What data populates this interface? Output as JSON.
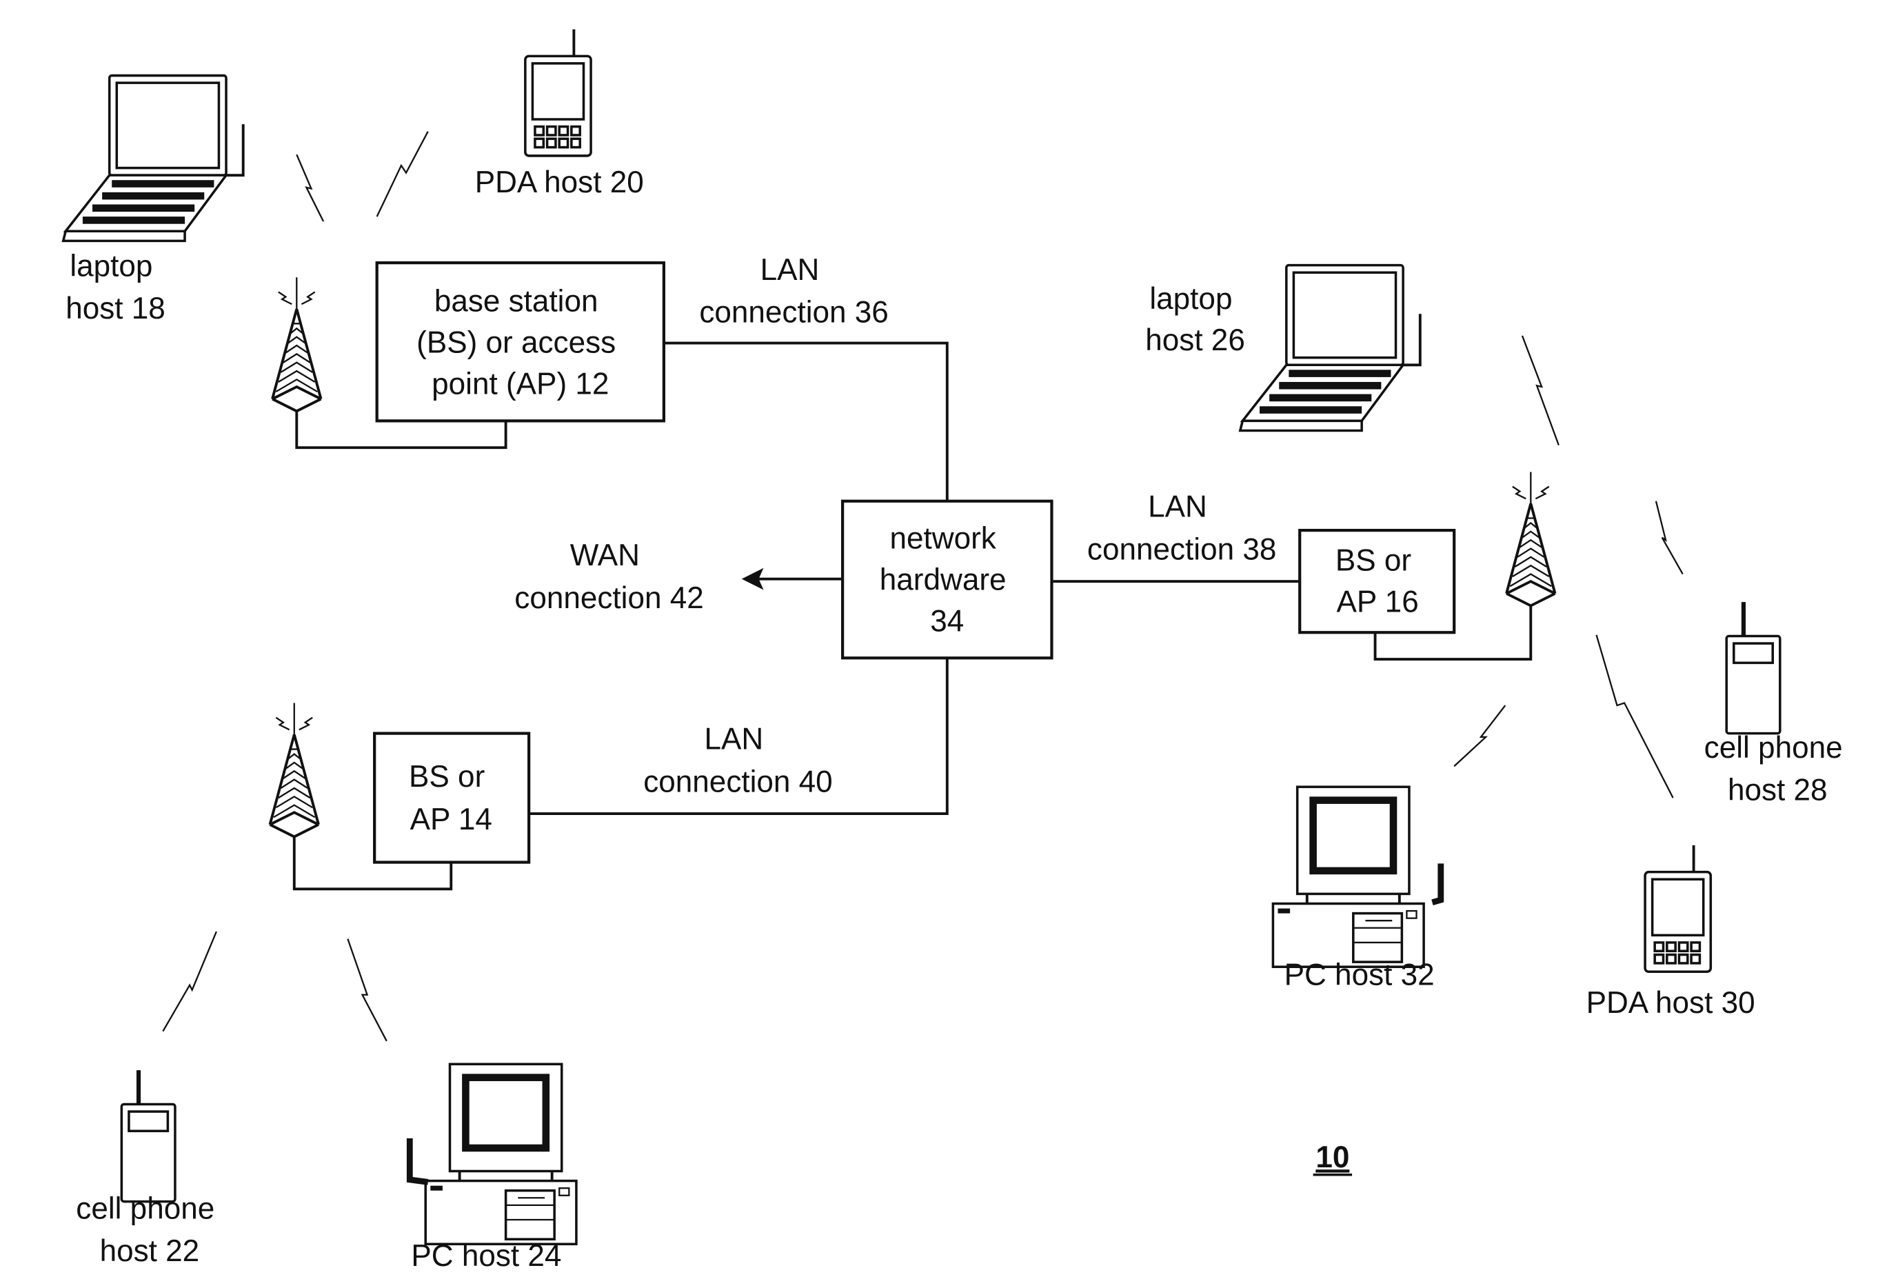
{
  "figure": {
    "number": "10",
    "nodes": {
      "bs12": [
        "base station",
        "(BS) or access",
        "point (AP) 12"
      ],
      "bs14": [
        "BS or",
        "AP 14"
      ],
      "bs16": [
        "BS or",
        "AP 16"
      ],
      "network_hardware": [
        "network",
        "hardware",
        "34"
      ]
    },
    "connections": {
      "lan36": [
        "LAN",
        "connection 36"
      ],
      "lan38": [
        "LAN",
        "connection 38"
      ],
      "lan40": [
        "LAN",
        "connection 40"
      ],
      "wan42": [
        "WAN",
        "connection 42"
      ]
    },
    "hosts": {
      "laptop18": [
        "laptop",
        "host 18"
      ],
      "pda20": [
        "PDA host 20"
      ],
      "cell22": [
        "cell phone",
        "host 22"
      ],
      "pc24": [
        "PC host 24"
      ],
      "laptop26": [
        "laptop",
        "host 26"
      ],
      "cell28": [
        "cell phone",
        "host 28"
      ],
      "pda30": [
        "PDA host 30"
      ],
      "pc32": [
        "PC host 32"
      ]
    }
  }
}
